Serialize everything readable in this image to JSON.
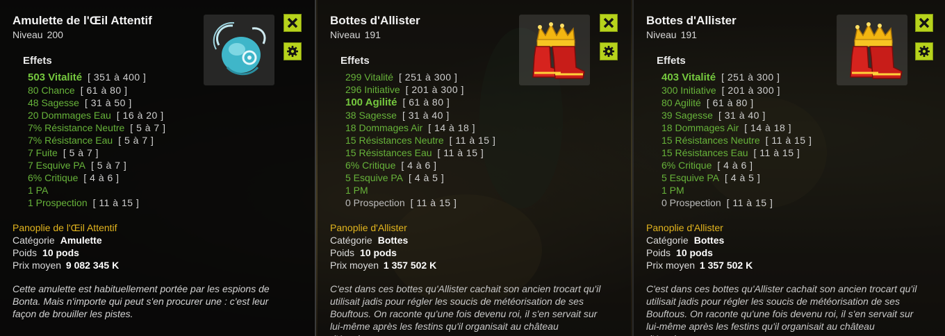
{
  "colors": {
    "accent_button": "#b7d31c",
    "effect_green": "#67b33a",
    "set_gold": "#e3b51e",
    "zero_grey": "#bdbdbd"
  },
  "icons": {
    "close": "close-x-icon",
    "settings": "gear-icon"
  },
  "tooltips": [
    {
      "title": "Amulette de l'Œil Attentif",
      "level_label": "Niveau",
      "level": "200",
      "effects_label": "Effets",
      "effects": [
        {
          "text": "503 Vitalité",
          "range": "[ 351 à 400 ]",
          "style": "big"
        },
        {
          "text": "80 Chance",
          "range": "[ 61 à 80 ]",
          "style": "normal"
        },
        {
          "text": "48 Sagesse",
          "range": "[ 31 à 50 ]",
          "style": "normal"
        },
        {
          "text": "20 Dommages Eau",
          "range": "[ 16 à 20 ]",
          "style": "normal"
        },
        {
          "text": "7% Résistance Neutre",
          "range": "[ 5 à 7 ]",
          "style": "normal"
        },
        {
          "text": "7% Résistance Eau",
          "range": "[ 5 à 7 ]",
          "style": "normal"
        },
        {
          "text": "7 Fuite",
          "range": "[ 5 à 7 ]",
          "style": "normal"
        },
        {
          "text": "7 Esquive PA",
          "range": "[ 5 à 7 ]",
          "style": "normal"
        },
        {
          "text": "6% Critique",
          "range": "[ 4 à 6 ]",
          "style": "normal"
        },
        {
          "text": "1 PA",
          "range": "",
          "style": "normal"
        },
        {
          "text": "1 Prospection",
          "range": "[ 11 à 15 ]",
          "style": "normal"
        }
      ],
      "set_name": "Panoplie de l'Œil Attentif",
      "category_label": "Catégorie",
      "category": "Amulette",
      "weight_label": "Poids",
      "weight": "10 pods",
      "price_label": "Prix moyen",
      "price": "9 082 345 K",
      "description": "Cette amulette est habituellement portée par les espions de Bonta. Mais n'importe qui peut s'en procurer une : c'est leur façon de brouiller les pistes.",
      "image_icon": "amulet-icon"
    },
    {
      "title": "Bottes d'Allister",
      "level_label": "Niveau",
      "level": "191",
      "effects_label": "Effets",
      "effects": [
        {
          "text": "299 Vitalité",
          "range": "[ 251 à 300 ]",
          "style": "normal"
        },
        {
          "text": "296 Initiative",
          "range": "[ 201 à 300 ]",
          "style": "normal"
        },
        {
          "text": "100 Agilité",
          "range": "[ 61 à 80 ]",
          "style": "big"
        },
        {
          "text": "38 Sagesse",
          "range": "[ 31 à 40 ]",
          "style": "normal"
        },
        {
          "text": "18 Dommages Air",
          "range": "[ 14 à 18 ]",
          "style": "normal"
        },
        {
          "text": "15 Résistances Neutre",
          "range": "[ 11 à 15 ]",
          "style": "normal"
        },
        {
          "text": "15 Résistances Eau",
          "range": "[ 11 à 15 ]",
          "style": "normal"
        },
        {
          "text": "6% Critique",
          "range": "[ 4 à 6 ]",
          "style": "normal"
        },
        {
          "text": "5 Esquive PA",
          "range": "[ 4 à 5 ]",
          "style": "normal"
        },
        {
          "text": "1 PM",
          "range": "",
          "style": "normal"
        },
        {
          "text": "0 Prospection",
          "range": "[ 11 à 15 ]",
          "style": "zero"
        }
      ],
      "set_name": "Panoplie d'Allister",
      "category_label": "Catégorie",
      "category": "Bottes",
      "weight_label": "Poids",
      "weight": "10 pods",
      "price_label": "Prix moyen",
      "price": "1 357 502 K",
      "description": "C'est dans ces bottes qu'Allister cachait son ancien trocart qu'il utilisait jadis pour régler les soucis de météorisation de ses Bouftous. On raconte qu'une fois devenu roi, il s'en servait sur lui-même après les festins qu'il organisait au château d'Amakna.",
      "image_icon": "crowned-boots-icon"
    },
    {
      "title": "Bottes d'Allister",
      "level_label": "Niveau",
      "level": "191",
      "effects_label": "Effets",
      "effects": [
        {
          "text": "403 Vitalité",
          "range": "[ 251 à 300 ]",
          "style": "big"
        },
        {
          "text": "300 Initiative",
          "range": "[ 201 à 300 ]",
          "style": "normal"
        },
        {
          "text": "80 Agilité",
          "range": "[ 61 à 80 ]",
          "style": "normal"
        },
        {
          "text": "39 Sagesse",
          "range": "[ 31 à 40 ]",
          "style": "normal"
        },
        {
          "text": "18 Dommages Air",
          "range": "[ 14 à 18 ]",
          "style": "normal"
        },
        {
          "text": "15 Résistances Neutre",
          "range": "[ 11 à 15 ]",
          "style": "normal"
        },
        {
          "text": "15 Résistances Eau",
          "range": "[ 11 à 15 ]",
          "style": "normal"
        },
        {
          "text": "6% Critique",
          "range": "[ 4 à 6 ]",
          "style": "normal"
        },
        {
          "text": "5 Esquive PA",
          "range": "[ 4 à 5 ]",
          "style": "normal"
        },
        {
          "text": "1 PM",
          "range": "",
          "style": "normal"
        },
        {
          "text": "0 Prospection",
          "range": "[ 11 à 15 ]",
          "style": "zero"
        }
      ],
      "set_name": "Panoplie d'Allister",
      "category_label": "Catégorie",
      "category": "Bottes",
      "weight_label": "Poids",
      "weight": "10 pods",
      "price_label": "Prix moyen",
      "price": "1 357 502 K",
      "description": "C'est dans ces bottes qu'Allister cachait son ancien trocart qu'il utilisait jadis pour régler les soucis de météorisation de ses Bouftous. On raconte qu'une fois devenu roi, il s'en servait sur lui-même après les festins qu'il organisait au château d'Amakna.",
      "image_icon": "crowned-boots-icon"
    }
  ]
}
